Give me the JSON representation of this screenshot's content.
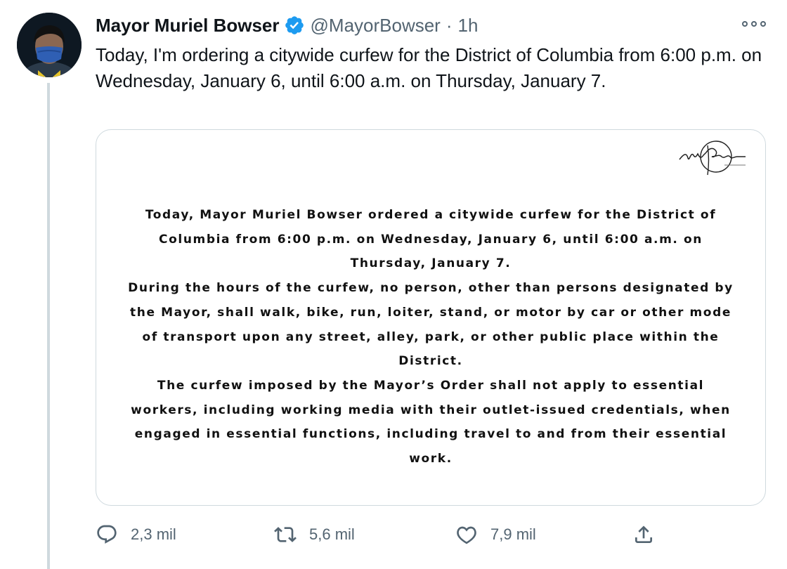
{
  "tweet": {
    "author_name": "Mayor Muriel Bowser",
    "verified": true,
    "handle": "@MayorBowser",
    "separator": "·",
    "time": "1h",
    "text": "Today, I'm ordering a citywide curfew for the District of Columbia from 6:00 p.m. on Wednesday, January 6, until 6:00 a.m. on Thursday, January 7."
  },
  "card": {
    "signature": "Muriel Bowser",
    "paragraphs": [
      "Today, Mayor Muriel Bowser ordered a citywide curfew for the District of Columbia from 6:00 p.m. on Wednesday, January 6, until 6:00 a.m. on Thursday, January 7.",
      "During the hours of the curfew, no person, other than persons designated by the Mayor, shall walk, bike, run, loiter, stand, or motor by car or other mode of transport upon any street, alley, park, or other public place within the District.",
      "The curfew imposed by the Mayor’s Order shall not apply to essential workers, including working media with their outlet-issued credentials, when engaged in essential functions, including travel to and from their essential work."
    ]
  },
  "actions": {
    "replies": "2,3 mil",
    "retweets": "5,6 mil",
    "likes": "7,9 mil"
  },
  "colors": {
    "verified_badge": "#1d9bf0",
    "secondary_text": "#536471",
    "border": "#cfd9de"
  }
}
